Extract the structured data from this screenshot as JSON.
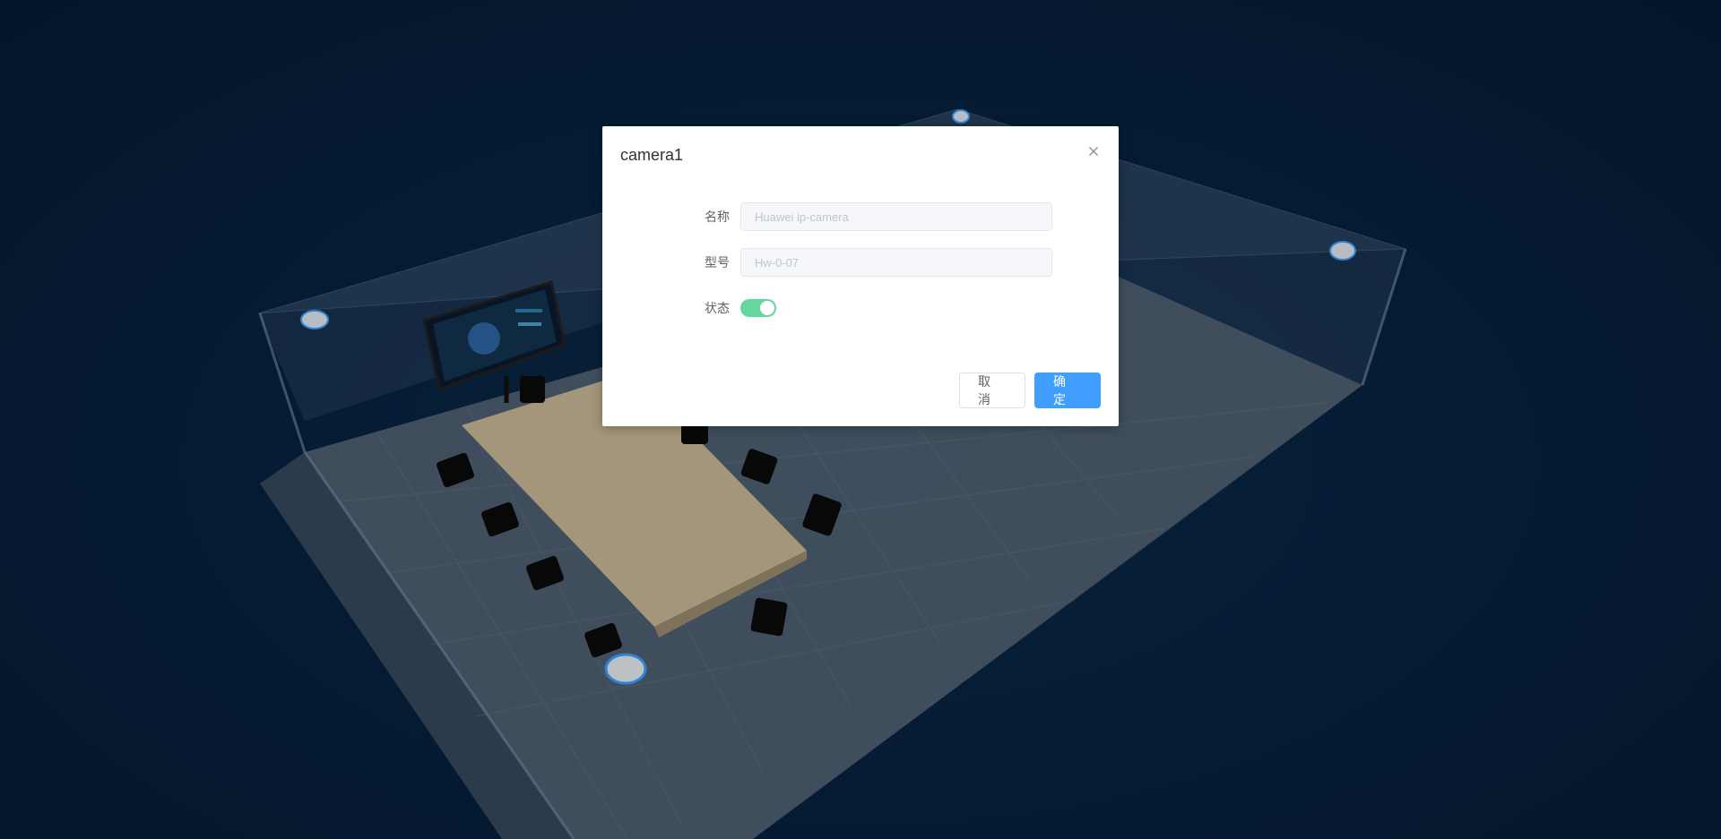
{
  "dialog": {
    "title": "camera1",
    "fields": {
      "name": {
        "label": "名称",
        "placeholder": "Huawei ip-camera"
      },
      "model": {
        "label": "型号",
        "placeholder": "Hw-0-07"
      },
      "status": {
        "label": "状态",
        "enabled": true
      }
    },
    "buttons": {
      "cancel": "取 消",
      "confirm": "确 定"
    }
  },
  "colors": {
    "background": "#06203d",
    "primary": "#409eff",
    "switch_on": "#67d69e"
  }
}
